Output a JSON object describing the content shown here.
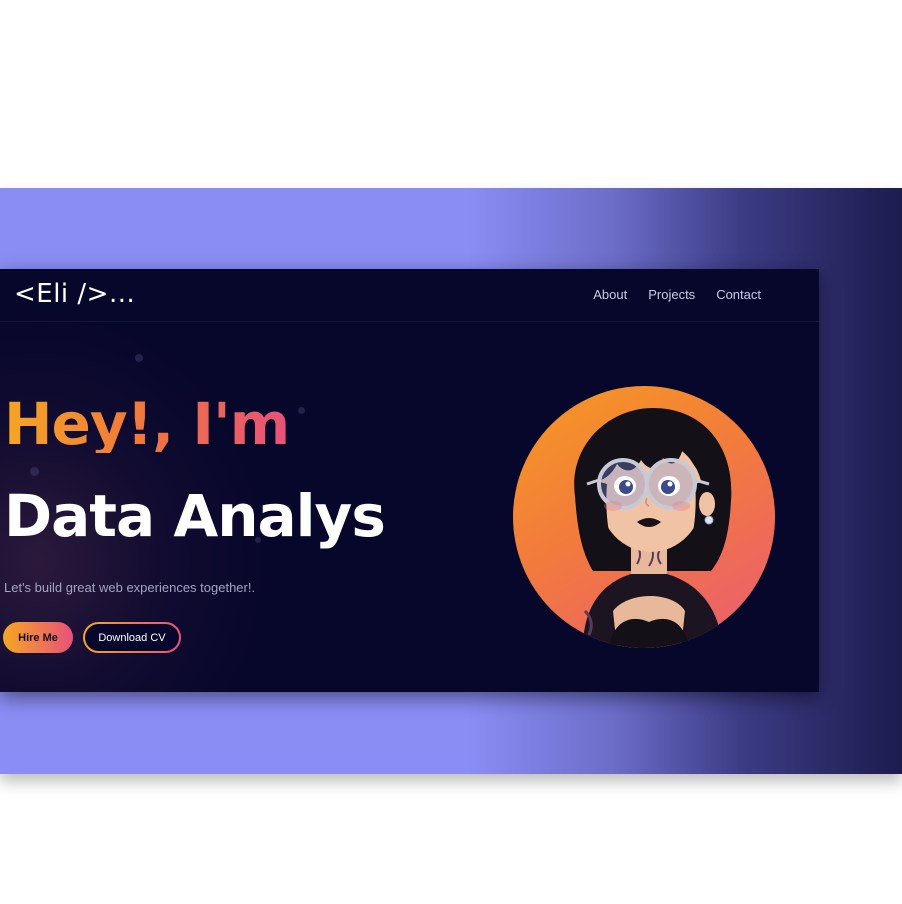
{
  "logo": "<Eli />...",
  "nav": {
    "items": [
      "About",
      "Projects",
      "Contact"
    ]
  },
  "hero": {
    "greeting": "Hey!, I'm",
    "role": "Data Analys",
    "tagline": "Let's build great web experiences together!.",
    "hire_label": "Hire Me",
    "cv_label": "Download CV"
  },
  "colors": {
    "background": "#07072b",
    "accent_start": "#f5a623",
    "accent_end": "#e8517a",
    "frame": "#8a8df4"
  },
  "icons": {
    "avatar": "cartoon-girl-portrait"
  }
}
